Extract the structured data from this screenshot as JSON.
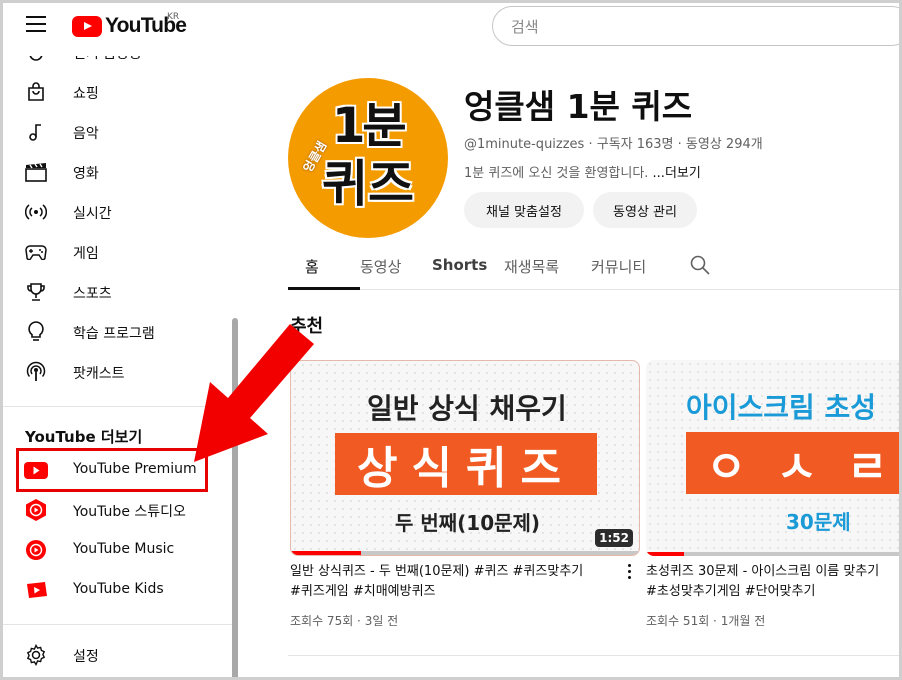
{
  "header": {
    "logo_text": "YouTube",
    "region": "KR",
    "search_placeholder": "검색"
  },
  "sidebar": {
    "items": [
      {
        "label": "인기 급상승",
        "icon": "trending-icon"
      },
      {
        "label": "쇼핑",
        "icon": "shopping-bag-icon"
      },
      {
        "label": "음악",
        "icon": "music-note-icon"
      },
      {
        "label": "영화",
        "icon": "clapperboard-icon"
      },
      {
        "label": "실시간",
        "icon": "live-broadcast-icon"
      },
      {
        "label": "게임",
        "icon": "gamepad-icon"
      },
      {
        "label": "스포츠",
        "icon": "trophy-icon"
      },
      {
        "label": "학습 프로그램",
        "icon": "lightbulb-icon"
      },
      {
        "label": "팟캐스트",
        "icon": "podcast-icon"
      }
    ],
    "more_section_title": "YouTube 더보기",
    "more_items": [
      {
        "label": "YouTube Premium",
        "icon": "youtube-premium-icon"
      },
      {
        "label": "YouTube 스튜디오",
        "icon": "youtube-studio-icon"
      },
      {
        "label": "YouTube Music",
        "icon": "youtube-music-icon"
      },
      {
        "label": "YouTube Kids",
        "icon": "youtube-kids-icon"
      }
    ],
    "settings_label": "설정"
  },
  "channel": {
    "avatar_big1": "1분",
    "avatar_big2": "퀴즈",
    "avatar_small": "엉클샘",
    "name": "엉클샘 1분 퀴즈",
    "meta": "@1minute-quizzes · 구독자 163명 · 동영상 294개",
    "description": "1분 퀴즈에 오신 것을 환영합니다. ",
    "more": "...더보기",
    "customize_button": "채널 맞춤설정",
    "manage_button": "동영상 관리"
  },
  "tabs": [
    "홈",
    "동영상",
    "Shorts",
    "재생목록",
    "커뮤니티"
  ],
  "section_title": "추천",
  "videos": [
    {
      "thumb_top": "일반 상식 채우기",
      "thumb_box": "상식퀴즈",
      "thumb_bottom": "두 번째(10문제)",
      "duration": "1:52",
      "title_line1": "일반 상식퀴즈 - 두 번째(10문제) #퀴즈 #퀴즈맞추기",
      "title_line2": "#퀴즈게임 #치매예방퀴즈",
      "meta": "조회수 75회 · 3일 전",
      "progress": 0.2
    },
    {
      "thumb_top": "아이스크림 초성",
      "thumb_box": "ㅇㅅㄹ",
      "thumb_bottom": "30문제",
      "title_line1": "초성퀴즈 30문제 - 아이스크림 이름 맞추기",
      "title_line2": "#초성맞추기게임 #단어맞추기",
      "meta": "조회수 51회 · 1개월 전",
      "progress": 0.15
    }
  ],
  "colors": {
    "brand_red": "#ff0000",
    "highlight_red": "#e60000",
    "thumb_orange": "#f15a22",
    "avatar_orange": "#f49b00",
    "ice_blue": "#1a9ad6"
  }
}
